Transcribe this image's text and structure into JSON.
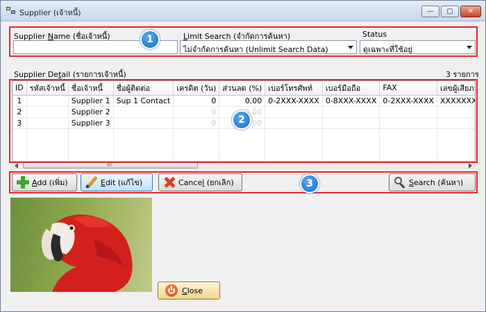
{
  "window": {
    "title": "Supplier (เจ้าหนี้)",
    "minimize_glyph": "—",
    "maximize_glyph": "▢",
    "close_glyph": "✕"
  },
  "search": {
    "name_label_pre": "Supplier ",
    "name_label_key": "N",
    "name_label_post": "ame (ชื่อเจ้าหนี้)",
    "name_value": "",
    "limit_label_key": "L",
    "limit_label_post": "imit Search (จำกัดการค้นหา)",
    "limit_value": "ไม่จำกัดการค้นหา (Unlimit Search Data)",
    "status_label": "Status",
    "status_value": "ดูเฉพาะที่ใช้อยู่"
  },
  "detail": {
    "label_pre": "Supplier De",
    "label_key": "t",
    "label_post": "ail (รายการเจ้าหนี้)",
    "count_text": "3 รายการ"
  },
  "grid": {
    "columns": [
      "ID",
      "รหัสเจ้าหนี้",
      "ชื่อเจ้าหนี้",
      "ชื่อผู้ติดต่อ",
      "เครดิต (วัน)",
      "ส่วนลด (%)",
      "เบอร์โทรศัพท์",
      "เบอร์มือถือ",
      "FAX",
      "เลขผู้เสียภาษี"
    ],
    "rows": [
      {
        "id": "1",
        "code": "",
        "name": "Supplier 1",
        "contact": "Sup 1 Contact",
        "credit": "0",
        "discount": "0.00",
        "phone": "0-2XXX-XXXX",
        "mobile": "0-8XXX-XXXX",
        "fax": "0-2XXX-XXXX",
        "tax": "XXXXXXXXX"
      },
      {
        "id": "2",
        "code": "",
        "name": "Supplier 2",
        "contact": "",
        "credit": "0",
        "discount": "0.00",
        "phone": "",
        "mobile": "",
        "fax": "",
        "tax": ""
      },
      {
        "id": "3",
        "code": "",
        "name": "Supplier 3",
        "contact": "",
        "credit": "0",
        "discount": "0.00",
        "phone": "",
        "mobile": "",
        "fax": "",
        "tax": ""
      }
    ],
    "scroll_grip": "III"
  },
  "buttons": {
    "add_key": "A",
    "add_post": "dd (เพิ่ม)",
    "edit_key": "E",
    "edit_post": "dit (แก้ไข)",
    "cancel_pre": "Cance",
    "cancel_key": "l",
    "cancel_post": " (ยกเลิก)",
    "search_key": "S",
    "search_post": "earch (ค้นหา)",
    "close_key": "C",
    "close_post": "lose"
  },
  "badges": [
    "1",
    "2",
    "3"
  ],
  "colors": {
    "highlight_box": "#e8262a",
    "badge": "#1a6cc2",
    "add_icon": "#3aa52d",
    "cancel_icon": "#d9411e",
    "close_icon": "#d94a1a"
  }
}
